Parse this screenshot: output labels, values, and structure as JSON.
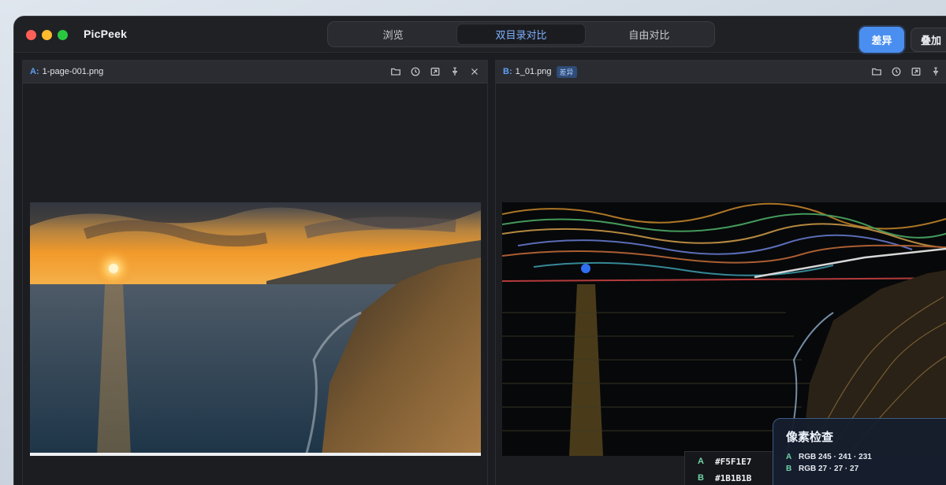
{
  "app": {
    "title": "PicPeek"
  },
  "mode_tabs": [
    {
      "label": "浏览",
      "active": false
    },
    {
      "label": "双目录对比",
      "active": true
    },
    {
      "label": "自由对比",
      "active": false
    }
  ],
  "actions": {
    "diff_label": "差异",
    "overlay_label": "叠加"
  },
  "pane_a": {
    "tag": "A:",
    "file_name": "1-page-001.png"
  },
  "pane_b": {
    "tag": "B:",
    "file_name": "1_01.png",
    "badge": "差异"
  },
  "pane_tools": [
    "folder-icon",
    "history-icon",
    "fit-icon",
    "pin-icon",
    "close-icon"
  ],
  "pixel_inspector": {
    "title": "像素检查",
    "a_label": "A",
    "a_value": "RGB 245 · 241 · 231",
    "b_label": "B",
    "b_value": "RGB 27 · 27 · 27"
  },
  "hex_readout": {
    "a_label": "A",
    "a_hex": "#F5F1E7",
    "b_label": "B",
    "b_hex": "#1B1B1B"
  },
  "colors": {
    "accent": "#4a8ff0",
    "tab_active_text": "#7fb2ff",
    "inspector_label": "#6fd3a6"
  }
}
